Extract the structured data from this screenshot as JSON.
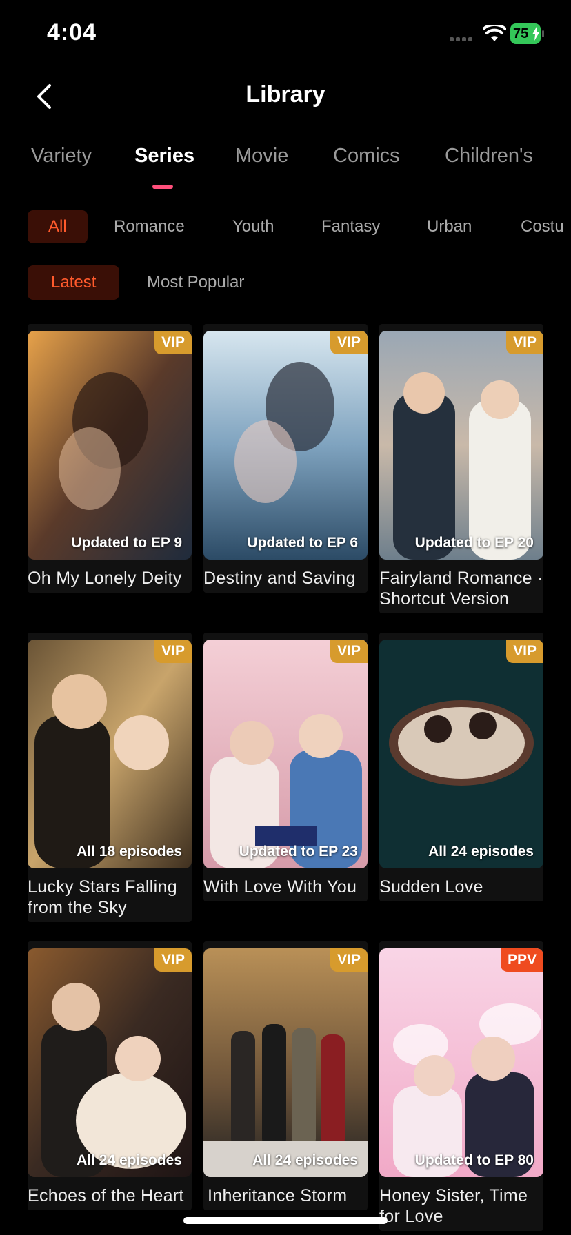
{
  "status_bar": {
    "time": "4:04",
    "battery_level": "75"
  },
  "header": {
    "title": "Library"
  },
  "tabs": [
    {
      "label": "Variety",
      "active": false
    },
    {
      "label": "Series",
      "active": true
    },
    {
      "label": "Movie",
      "active": false
    },
    {
      "label": "Comics",
      "active": false
    },
    {
      "label": "Children's",
      "active": false
    }
  ],
  "genres": [
    {
      "label": "All",
      "active": true
    },
    {
      "label": "Romance",
      "active": false
    },
    {
      "label": "Youth",
      "active": false
    },
    {
      "label": "Fantasy",
      "active": false
    },
    {
      "label": "Urban",
      "active": false
    },
    {
      "label": "Costu",
      "active": false
    }
  ],
  "sorts": [
    {
      "label": "Latest",
      "active": true
    },
    {
      "label": "Most Popular",
      "active": false
    }
  ],
  "colors": {
    "accent": "#ff5a2c",
    "chip_bg": "#3a0f06",
    "tab_indicator": "#ff4f7b",
    "vip": "#d79b2d",
    "ppv": "#ef4b1f"
  },
  "cards": [
    {
      "title": "Oh My Lonely Deity",
      "badge": "VIP",
      "status": "Updated to EP 9"
    },
    {
      "title": "Destiny and Saving",
      "badge": "VIP",
      "status": "Updated to EP 6"
    },
    {
      "title": "Fairyland Romance · Shortcut Version",
      "badge": "VIP",
      "status": "Updated to EP 20"
    },
    {
      "title": "Lucky Stars Falling from the Sky",
      "badge": "VIP",
      "status": "All 18 episodes"
    },
    {
      "title": "With Love With You",
      "badge": "VIP",
      "status": "Updated to EP 23"
    },
    {
      "title": "Sudden Love",
      "badge": "VIP",
      "status": "All 24 episodes"
    },
    {
      "title": "Echoes of the Heart",
      "badge": "VIP",
      "status": "All 24 episodes"
    },
    {
      "title": "Inheritance Storm",
      "badge": "VIP",
      "status": "All 24 episodes"
    },
    {
      "title": "Honey Sister, Time for Love",
      "badge": "PPV",
      "status": "Updated to EP 80"
    }
  ]
}
